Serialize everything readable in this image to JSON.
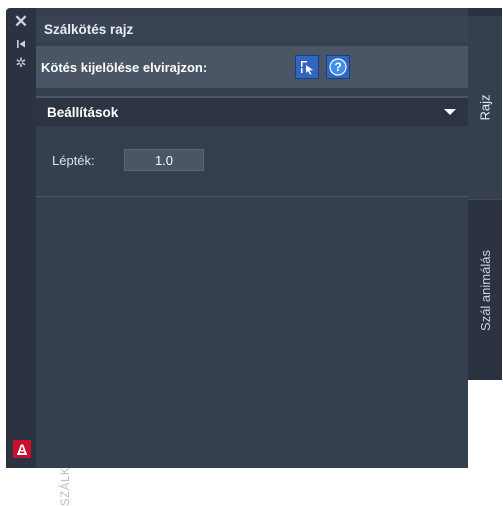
{
  "sidebar": {
    "close_icon": "close-icon",
    "pin_icon": "pin-icon",
    "settings_icon": "gear-icon",
    "title": "SZÁLKÖTÉS",
    "logo_letter": "A",
    "logo_color": "#c8102e"
  },
  "panel": {
    "title": "Szálkötés rajz",
    "select_label": "Kötés kijelölése elvirajzon:",
    "select_button_icon": "select-object-icon",
    "help_button_icon": "help-icon"
  },
  "settings": {
    "header": "Beállítások",
    "scale_label": "Lépték:",
    "scale_value": "1.0"
  },
  "tabs": [
    {
      "label": "Rajz",
      "active": true
    },
    {
      "label": "Szál animálás",
      "active": false
    }
  ],
  "colors": {
    "accent": "#2f66c0",
    "panel_bg": "#353f4f",
    "sidebar_bg": "#2b3341"
  }
}
